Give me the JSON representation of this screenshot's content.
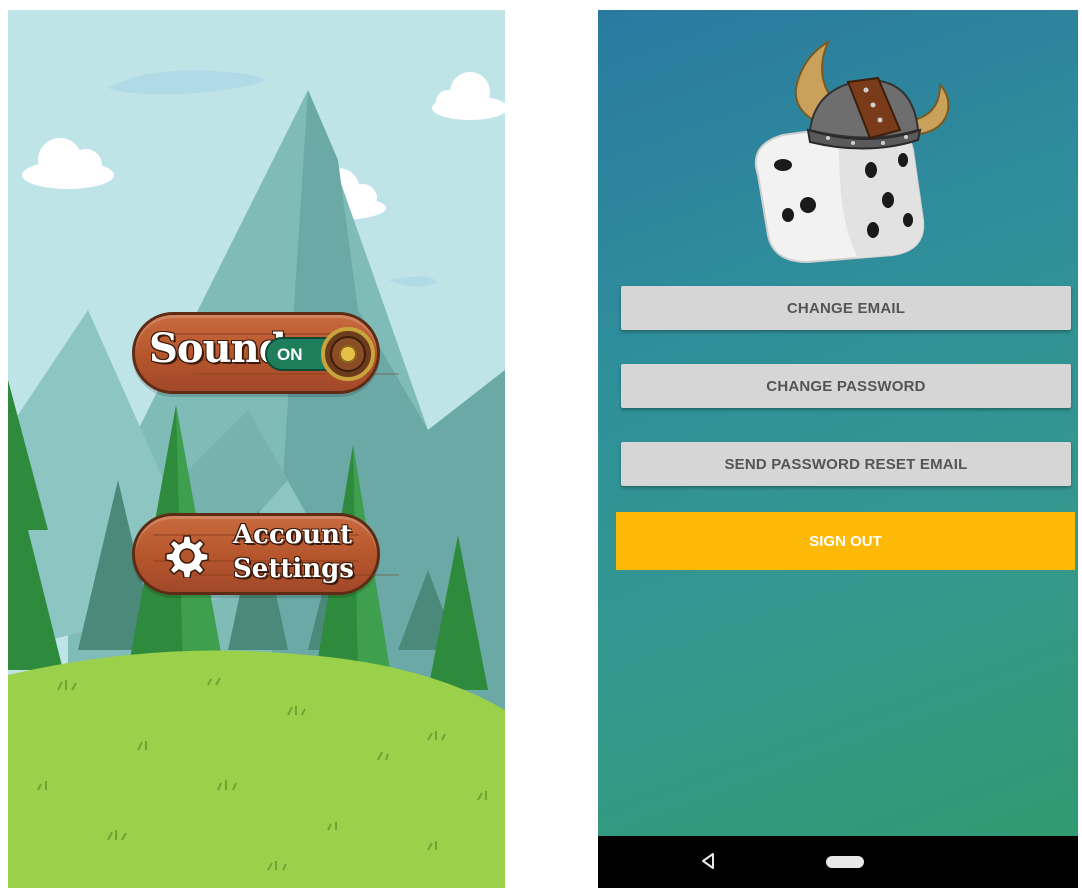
{
  "left_screen": {
    "sound": {
      "label": "Sound",
      "state": "ON"
    },
    "account": {
      "label_line1": "Account",
      "label_line2": "Settings"
    }
  },
  "right_screen": {
    "buttons": {
      "change_email": "CHANGE EMAIL",
      "change_password": "CHANGE PASSWORD",
      "send_reset": "SEND PASSWORD RESET EMAIL",
      "sign_out": "SIGN OUT"
    },
    "nav": {
      "back": "back-icon",
      "home": "home-pill"
    }
  },
  "colors": {
    "sign_out": "#fdb908",
    "toggle_on": "#1e7d5a",
    "wood": "#b5552c",
    "grass": "#9bd04a"
  }
}
